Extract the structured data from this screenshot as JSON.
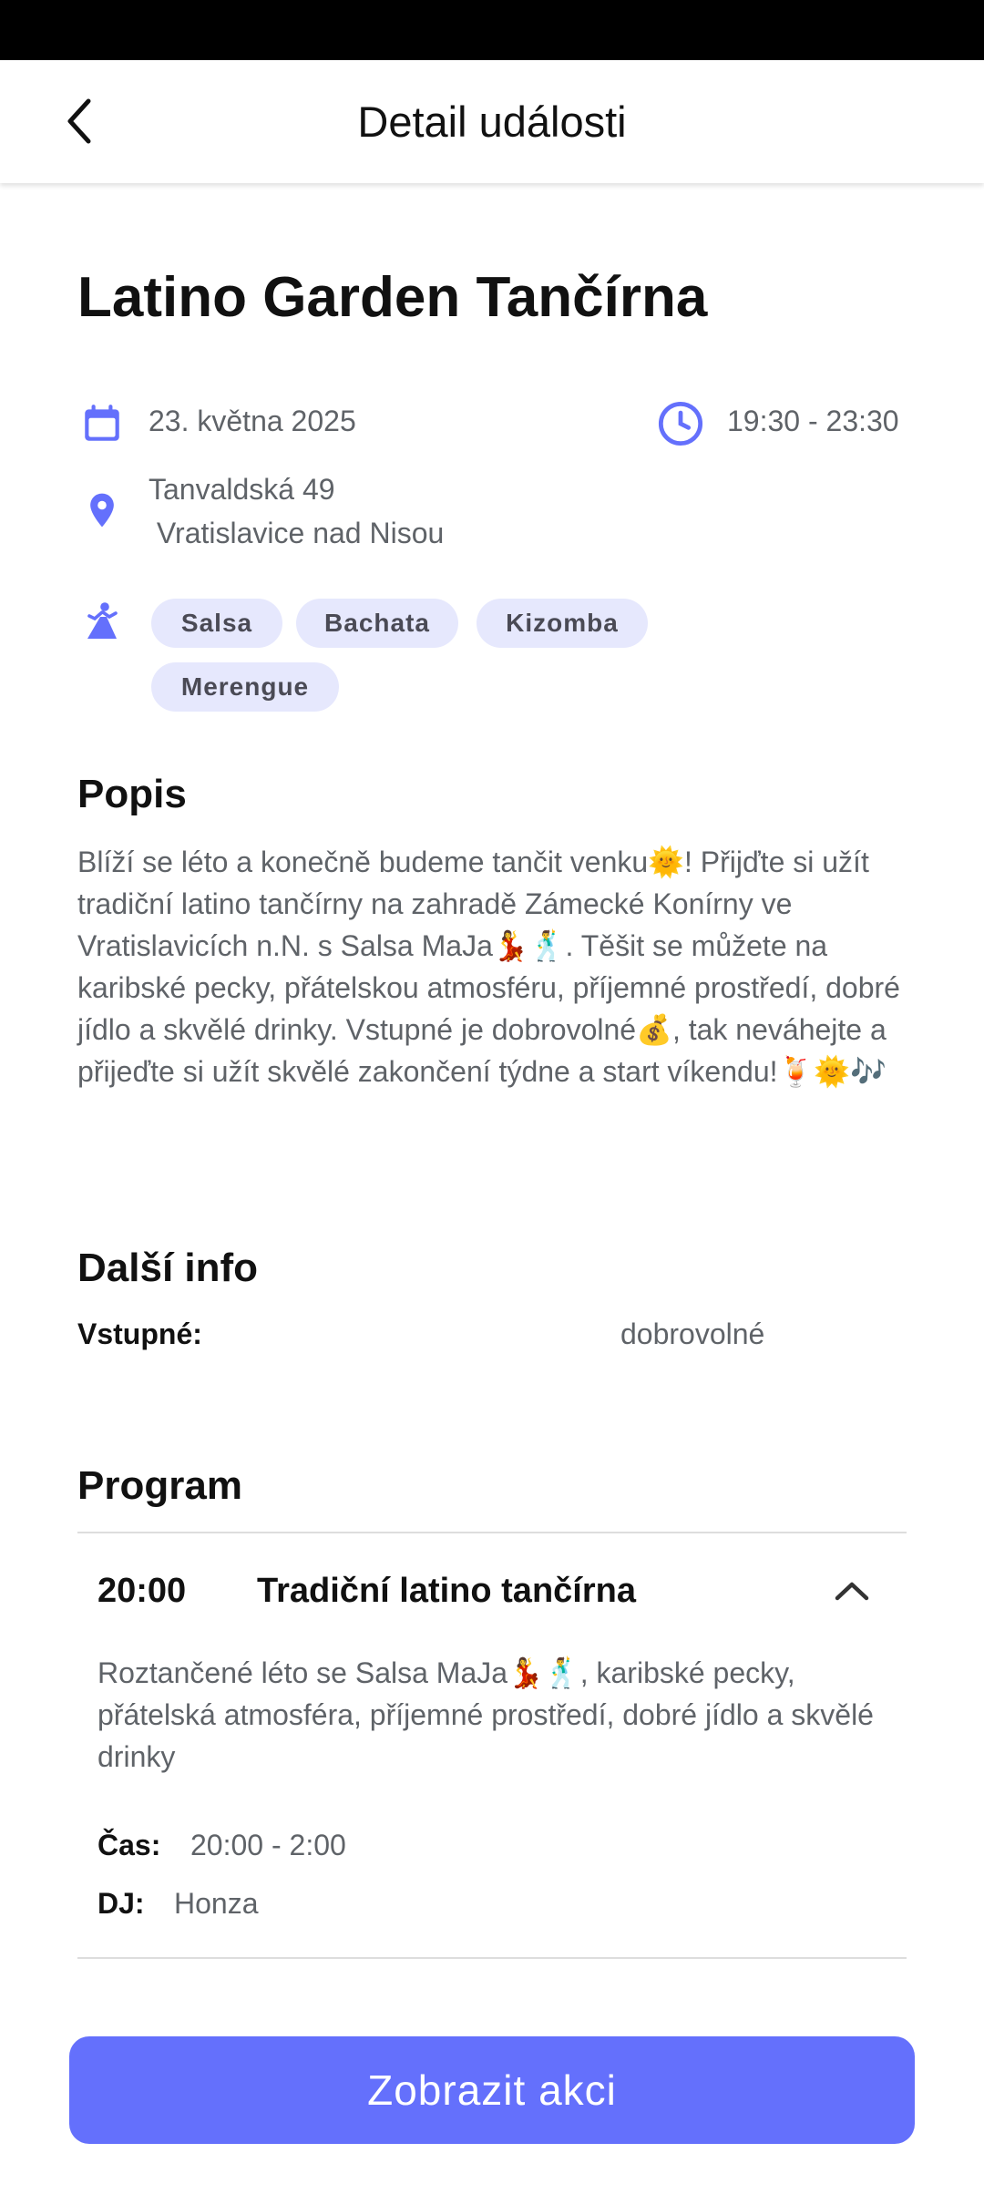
{
  "appbar": {
    "title": "Detail události"
  },
  "event": {
    "title": "Latino Garden Tančírna",
    "date": "23. května 2025",
    "time": "19:30 - 23:30",
    "address_line1": "Tanvaldská 49",
    "address_line2": " Vratislavice nad Nisou",
    "dance_styles": [
      "Salsa",
      "Bachata",
      "Kizomba",
      "Merengue"
    ]
  },
  "description": {
    "heading": "Popis",
    "text": "Blíží se léto a konečně budeme tančit venku🌞! Přijďte si užít tradiční latino tančírny na zahradě Zámecké Konírny ve Vratislavicích n.N. s Salsa MaJa💃🕺. Těšit se můžete na karibské pecky, přátelskou atmosféru, příjemné prostředí, dobré jídlo a skvělé drinky. Vstupné je dobrovolné💰, tak neváhejte a přijeďte si užít skvělé zakončení týdne a start víkendu!🍹🌞🎶"
  },
  "more_info": {
    "heading": "Další info",
    "entry_label": "Vstupné:",
    "entry_value": "dobrovolné"
  },
  "program": {
    "heading": "Program",
    "items": [
      {
        "time": "20:00",
        "title": "Tradiční latino tančírna",
        "description": "Roztančené léto se Salsa MaJa💃🕺, karibské pecky, přátelská atmosféra, příjemné prostředí, dobré jídlo a skvělé drinky",
        "time_label": "Čas:",
        "time_range": "20:00 - 2:00",
        "dj_label": "DJ:",
        "dj_name": "Honza"
      }
    ]
  },
  "cta": {
    "label": "Zobrazit akci"
  },
  "colors": {
    "accent": "#6470fc",
    "chip_bg": "#e6e8fd",
    "text_secondary": "#5f6368"
  },
  "icons": [
    "back-arrow-icon",
    "calendar-icon",
    "clock-icon",
    "location-pin-icon",
    "dancer-icon",
    "chevron-up-icon"
  ]
}
